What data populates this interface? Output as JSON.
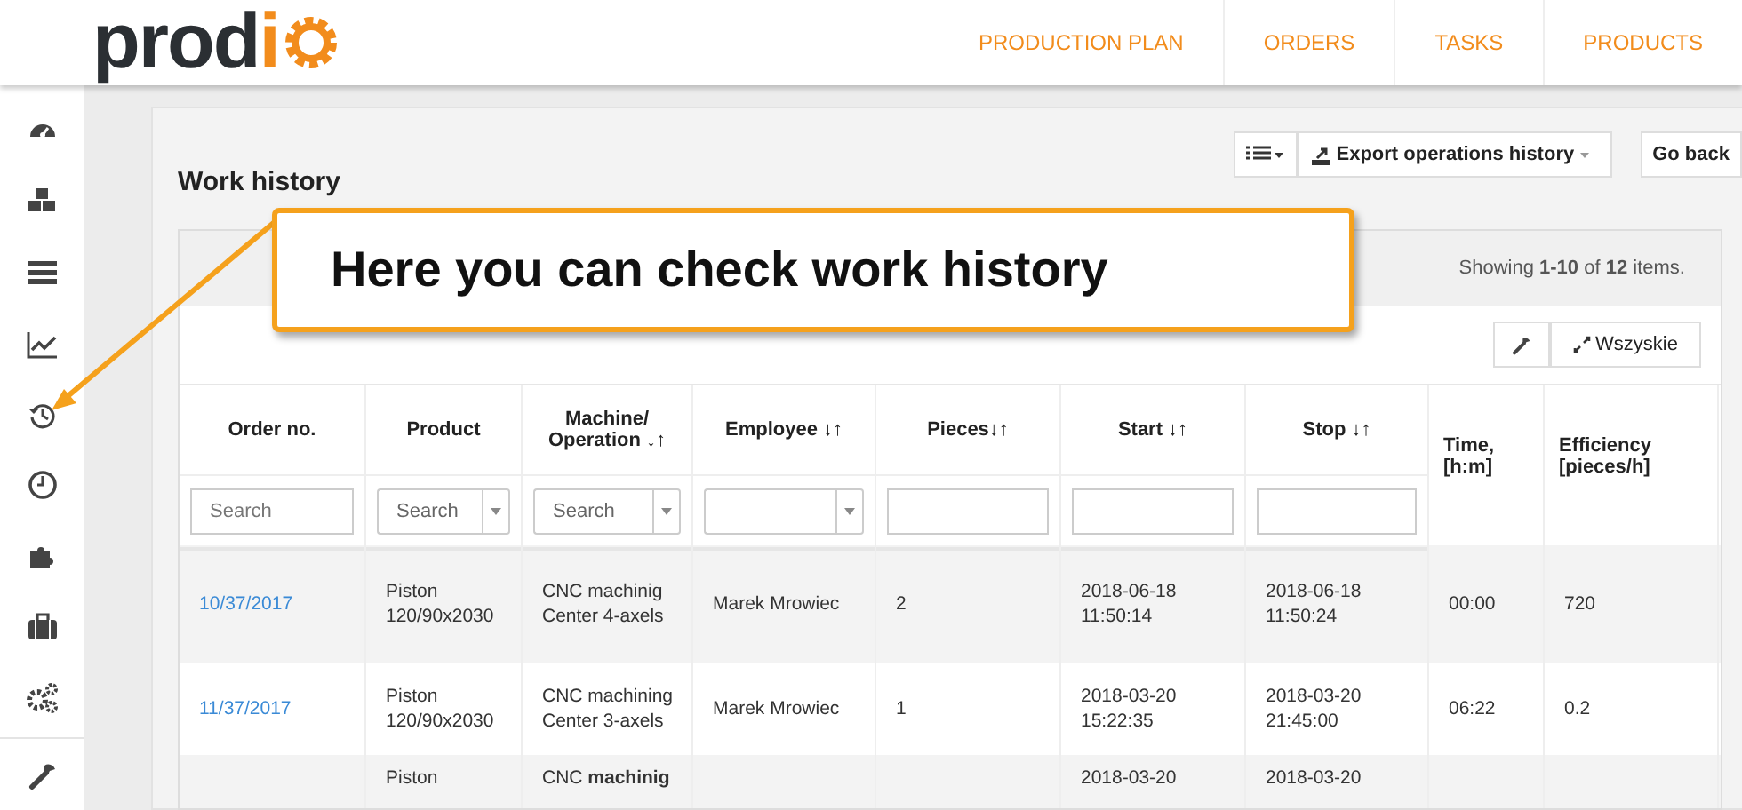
{
  "header": {
    "logo": {
      "dark": "prod",
      "accent": "i"
    },
    "nav": [
      {
        "label": "PRODUCTION PLAN"
      },
      {
        "label": "ORDERS"
      },
      {
        "label": "TASKS"
      },
      {
        "label": "PRODUCTS"
      }
    ]
  },
  "sidebar": {
    "items": [
      {
        "kind": "dashboard"
      },
      {
        "kind": "cubes"
      },
      {
        "kind": "rows"
      },
      {
        "kind": "chart"
      },
      {
        "kind": "history"
      },
      {
        "kind": "clock"
      },
      {
        "kind": "puzzle"
      },
      {
        "kind": "briefcase"
      },
      {
        "kind": "gears"
      },
      {
        "kind": "wrench"
      }
    ]
  },
  "page": {
    "title": "Work history",
    "toolbar": {
      "export": "Export operations history",
      "back": "Go back"
    }
  },
  "callout": {
    "text": "Here you can check work history"
  },
  "table": {
    "summary": "Showing **1-10** of **12** items.",
    "tools": {
      "expand": "Wszyskie"
    },
    "columns": [
      {
        "label": "Order no.",
        "filter": {
          "kind": "text",
          "placeholder": "Search"
        }
      },
      {
        "label": "Product",
        "filter": {
          "kind": "select",
          "placeholder": "Search"
        }
      },
      {
        "label": "Machine/ Operation ↓↑",
        "filter": {
          "kind": "select",
          "placeholder": "Search"
        }
      },
      {
        "label": "Employee ↓↑",
        "filter": {
          "kind": "select"
        }
      },
      {
        "label": "Pieces↓↑",
        "filter": {
          "kind": "text"
        }
      },
      {
        "label": "Start ↓↑",
        "filter": {
          "kind": "text"
        }
      },
      {
        "label": "Stop ↓↑",
        "filter": {
          "kind": "text"
        }
      },
      {
        "label": "Time, [h:m]",
        "filter": {
          "kind": "none"
        }
      },
      {
        "label": "Efficiency [pieces/h]",
        "filter": {
          "kind": "none"
        }
      }
    ],
    "rows": [
      {
        "order": "10/37/2017",
        "product": "Piston 120/90x2030",
        "machine": "CNC machinig Center 4-axels",
        "employee": "Marek Mrowiec",
        "pieces": "2",
        "start": "2018-06-18 11:50:14",
        "stop": "2018-06-18 11:50:24",
        "time": "00:00",
        "efficiency": "720"
      },
      {
        "order": "11/37/2017",
        "product": "Piston 120/90x2030",
        "machine": "CNC machining Center 3-axels",
        "employee": "Marek Mrowiec",
        "pieces": "1",
        "start": "2018-03-20 15:22:35",
        "stop": "2018-03-20 21:45:00",
        "time": "06:22",
        "efficiency": "0.2"
      },
      {
        "product": "Piston",
        "machine": "CNC **machinig**",
        "start": "2018-03-20",
        "stop": "2018-03-20"
      }
    ]
  }
}
